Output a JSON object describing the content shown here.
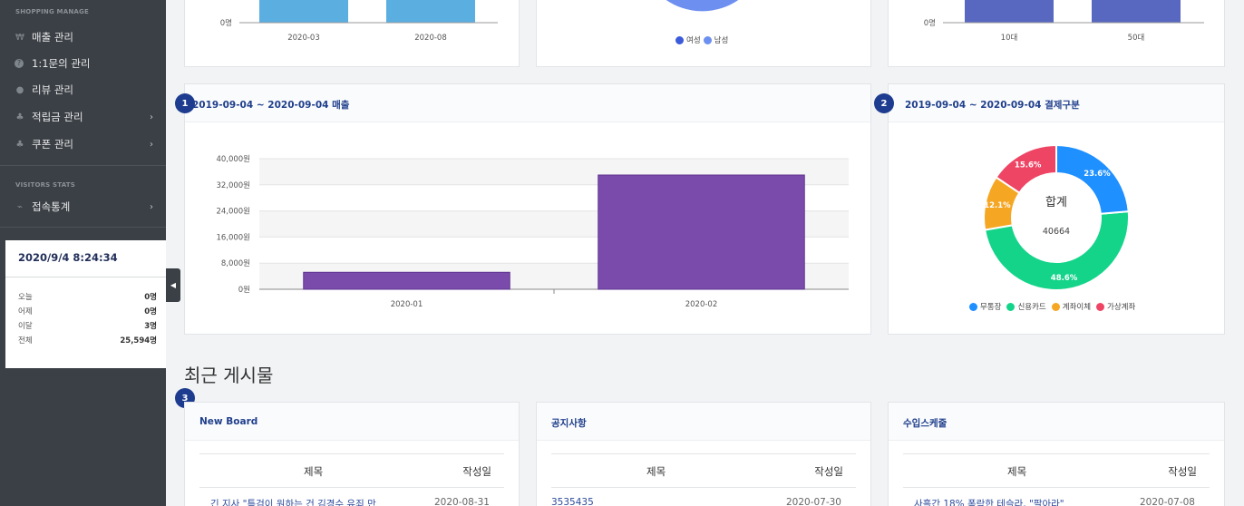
{
  "sidebar": {
    "shopping_heading": "SHOPPING MANAGE",
    "shopping_items": [
      {
        "icon": "won-icon",
        "glyph": "₩",
        "label": "매출 관리",
        "has_chevron": false
      },
      {
        "icon": "question-icon",
        "glyph": "?",
        "label": "1:1문의 관리",
        "has_chevron": false
      },
      {
        "icon": "comment-icon",
        "glyph": "●",
        "label": "리뷰 관리",
        "has_chevron": false
      },
      {
        "icon": "coin-icon",
        "glyph": "♣",
        "label": "적립금 관리",
        "has_chevron": true
      },
      {
        "icon": "coupon-icon",
        "glyph": "♣",
        "label": "쿠폰 관리",
        "has_chevron": true
      }
    ],
    "visitors_heading": "VISITORS STATS",
    "visitors_items": [
      {
        "icon": "line-chart-icon",
        "glyph": "⌁",
        "label": "접속통계",
        "has_chevron": true
      }
    ],
    "clock": "2020/9/4 8:24:34",
    "stats": [
      {
        "label": "오늘",
        "value": "0명"
      },
      {
        "label": "어제",
        "value": "0명"
      },
      {
        "label": "이달",
        "value": "3명"
      },
      {
        "label": "전체",
        "value": "25,594명"
      }
    ]
  },
  "top_cards": {
    "left": {
      "zero_label": "0명",
      "categories": [
        "2020-03",
        "2020-08"
      ]
    },
    "middle": {
      "legend": [
        {
          "label": "여성",
          "color": "#3b5bdb"
        },
        {
          "label": "남성",
          "color": "#6c8ff0"
        }
      ]
    },
    "right": {
      "zero_label": "0명",
      "categories": [
        "10대",
        "50대"
      ]
    }
  },
  "sales_card": {
    "badge": "1",
    "title": "2019-09-04 ~ 2020-09-04 매출"
  },
  "payment_card": {
    "badge": "2",
    "title": "2019-09-04 ~ 2020-09-04 결제구분",
    "center_label": "합계",
    "center_value": "40664"
  },
  "recent_section": {
    "title": "최근 게시물",
    "badge": "3"
  },
  "boards": [
    {
      "title": "New Board",
      "col_title": "제목",
      "col_date": "작성일",
      "row_title": "긴 지사 \"특검이 원하는 건 김경수 유죄 만",
      "row_date": "2020-08-31"
    },
    {
      "title": "공지사항",
      "col_title": "제목",
      "col_date": "작성일",
      "row_title": "3535435",
      "row_date": "2020-07-30"
    },
    {
      "title": "수입스케줄",
      "col_title": "제목",
      "col_date": "작성일",
      "row_title": "사흘간 18% 폭락한 테슬라, \"팔아라\"",
      "row_date": "2020-07-08"
    }
  ],
  "chart_data": [
    {
      "type": "bar",
      "title": "2019-09-04 ~ 2020-09-04 매출",
      "categories": [
        "2020-01",
        "2020-02"
      ],
      "values": [
        5200,
        35000
      ],
      "ylim": [
        0,
        40000
      ],
      "yticks": [
        "0원",
        "8,000원",
        "16,000원",
        "24,000원",
        "32,000원",
        "40,000원"
      ],
      "color": "#7b4bab"
    },
    {
      "type": "pie",
      "title": "2019-09-04 ~ 2020-09-04 결제구분",
      "labels": [
        "무통장",
        "신용카드",
        "계좌이체",
        "가상계좌"
      ],
      "values": [
        23.6,
        48.6,
        12.1,
        15.6
      ],
      "value_labels": [
        "23.6%",
        "48.6%",
        "12.1%",
        "15.6%"
      ],
      "colors": [
        "#1e90ff",
        "#14d48a",
        "#f5a623",
        "#ef4565"
      ]
    }
  ]
}
